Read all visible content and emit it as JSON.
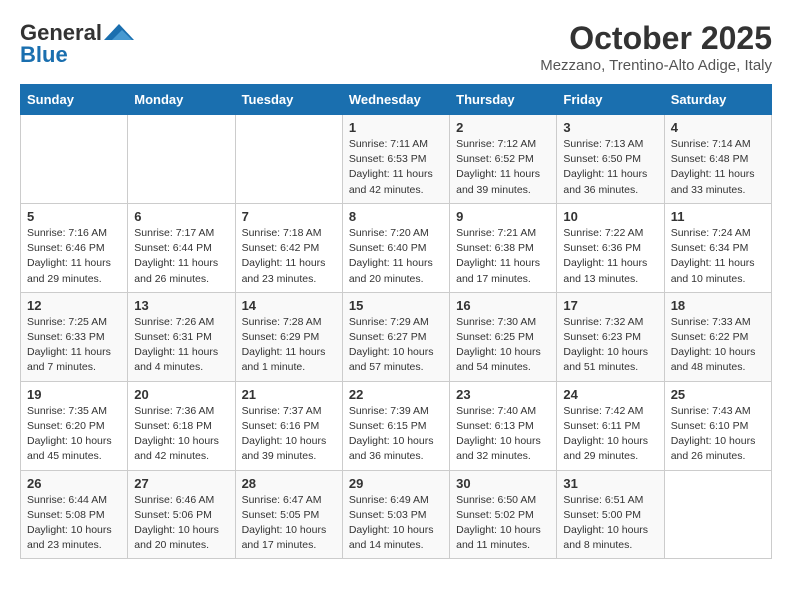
{
  "header": {
    "logo_line1": "General",
    "logo_line2": "Blue",
    "month": "October 2025",
    "location": "Mezzano, Trentino-Alto Adige, Italy"
  },
  "days_of_week": [
    "Sunday",
    "Monday",
    "Tuesday",
    "Wednesday",
    "Thursday",
    "Friday",
    "Saturday"
  ],
  "weeks": [
    [
      {
        "day": "",
        "info": ""
      },
      {
        "day": "",
        "info": ""
      },
      {
        "day": "",
        "info": ""
      },
      {
        "day": "1",
        "info": "Sunrise: 7:11 AM\nSunset: 6:53 PM\nDaylight: 11 hours\nand 42 minutes."
      },
      {
        "day": "2",
        "info": "Sunrise: 7:12 AM\nSunset: 6:52 PM\nDaylight: 11 hours\nand 39 minutes."
      },
      {
        "day": "3",
        "info": "Sunrise: 7:13 AM\nSunset: 6:50 PM\nDaylight: 11 hours\nand 36 minutes."
      },
      {
        "day": "4",
        "info": "Sunrise: 7:14 AM\nSunset: 6:48 PM\nDaylight: 11 hours\nand 33 minutes."
      }
    ],
    [
      {
        "day": "5",
        "info": "Sunrise: 7:16 AM\nSunset: 6:46 PM\nDaylight: 11 hours\nand 29 minutes."
      },
      {
        "day": "6",
        "info": "Sunrise: 7:17 AM\nSunset: 6:44 PM\nDaylight: 11 hours\nand 26 minutes."
      },
      {
        "day": "7",
        "info": "Sunrise: 7:18 AM\nSunset: 6:42 PM\nDaylight: 11 hours\nand 23 minutes."
      },
      {
        "day": "8",
        "info": "Sunrise: 7:20 AM\nSunset: 6:40 PM\nDaylight: 11 hours\nand 20 minutes."
      },
      {
        "day": "9",
        "info": "Sunrise: 7:21 AM\nSunset: 6:38 PM\nDaylight: 11 hours\nand 17 minutes."
      },
      {
        "day": "10",
        "info": "Sunrise: 7:22 AM\nSunset: 6:36 PM\nDaylight: 11 hours\nand 13 minutes."
      },
      {
        "day": "11",
        "info": "Sunrise: 7:24 AM\nSunset: 6:34 PM\nDaylight: 11 hours\nand 10 minutes."
      }
    ],
    [
      {
        "day": "12",
        "info": "Sunrise: 7:25 AM\nSunset: 6:33 PM\nDaylight: 11 hours\nand 7 minutes."
      },
      {
        "day": "13",
        "info": "Sunrise: 7:26 AM\nSunset: 6:31 PM\nDaylight: 11 hours\nand 4 minutes."
      },
      {
        "day": "14",
        "info": "Sunrise: 7:28 AM\nSunset: 6:29 PM\nDaylight: 11 hours\nand 1 minute."
      },
      {
        "day": "15",
        "info": "Sunrise: 7:29 AM\nSunset: 6:27 PM\nDaylight: 10 hours\nand 57 minutes."
      },
      {
        "day": "16",
        "info": "Sunrise: 7:30 AM\nSunset: 6:25 PM\nDaylight: 10 hours\nand 54 minutes."
      },
      {
        "day": "17",
        "info": "Sunrise: 7:32 AM\nSunset: 6:23 PM\nDaylight: 10 hours\nand 51 minutes."
      },
      {
        "day": "18",
        "info": "Sunrise: 7:33 AM\nSunset: 6:22 PM\nDaylight: 10 hours\nand 48 minutes."
      }
    ],
    [
      {
        "day": "19",
        "info": "Sunrise: 7:35 AM\nSunset: 6:20 PM\nDaylight: 10 hours\nand 45 minutes."
      },
      {
        "day": "20",
        "info": "Sunrise: 7:36 AM\nSunset: 6:18 PM\nDaylight: 10 hours\nand 42 minutes."
      },
      {
        "day": "21",
        "info": "Sunrise: 7:37 AM\nSunset: 6:16 PM\nDaylight: 10 hours\nand 39 minutes."
      },
      {
        "day": "22",
        "info": "Sunrise: 7:39 AM\nSunset: 6:15 PM\nDaylight: 10 hours\nand 36 minutes."
      },
      {
        "day": "23",
        "info": "Sunrise: 7:40 AM\nSunset: 6:13 PM\nDaylight: 10 hours\nand 32 minutes."
      },
      {
        "day": "24",
        "info": "Sunrise: 7:42 AM\nSunset: 6:11 PM\nDaylight: 10 hours\nand 29 minutes."
      },
      {
        "day": "25",
        "info": "Sunrise: 7:43 AM\nSunset: 6:10 PM\nDaylight: 10 hours\nand 26 minutes."
      }
    ],
    [
      {
        "day": "26",
        "info": "Sunrise: 6:44 AM\nSunset: 5:08 PM\nDaylight: 10 hours\nand 23 minutes."
      },
      {
        "day": "27",
        "info": "Sunrise: 6:46 AM\nSunset: 5:06 PM\nDaylight: 10 hours\nand 20 minutes."
      },
      {
        "day": "28",
        "info": "Sunrise: 6:47 AM\nSunset: 5:05 PM\nDaylight: 10 hours\nand 17 minutes."
      },
      {
        "day": "29",
        "info": "Sunrise: 6:49 AM\nSunset: 5:03 PM\nDaylight: 10 hours\nand 14 minutes."
      },
      {
        "day": "30",
        "info": "Sunrise: 6:50 AM\nSunset: 5:02 PM\nDaylight: 10 hours\nand 11 minutes."
      },
      {
        "day": "31",
        "info": "Sunrise: 6:51 AM\nSunset: 5:00 PM\nDaylight: 10 hours\nand 8 minutes."
      },
      {
        "day": "",
        "info": ""
      }
    ]
  ]
}
